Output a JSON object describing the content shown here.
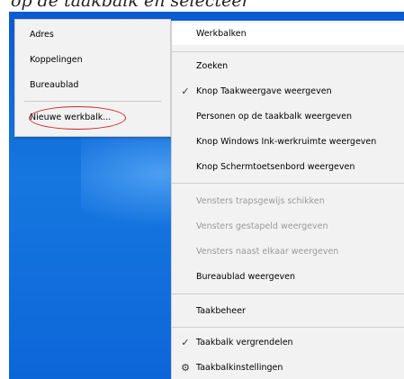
{
  "caption": "op de taakbalk en selecteer",
  "submenu": {
    "items": [
      {
        "label": "Adres"
      },
      {
        "label": "Koppelingen"
      },
      {
        "label": "Bureaublad"
      }
    ],
    "new_toolbar": "Nieuwe werkbalk..."
  },
  "menu": {
    "toolbars": "Werkbalken",
    "search": "Zoeken",
    "task_view": "Knop Taakweergave weergeven",
    "people": "Personen op de taakbalk weergeven",
    "ink": "Knop Windows Ink-werkruimte weergeven",
    "keyboard": "Knop Schermtoetsenbord weergeven",
    "cascade": "Vensters trapsgewijs schikken",
    "stacked": "Vensters gestapeld weergeven",
    "side_by_side": "Vensters naast elkaar weergeven",
    "show_desktop": "Bureaublad weergeven",
    "task_manager": "Taakbeheer",
    "lock": "Taakbalk vergrendelen",
    "settings": "Taakbalkinstellingen"
  },
  "colors": {
    "menu_bg": "#f2f2f2",
    "highlight": "#ffffff",
    "desktop": "#1677e0",
    "circle": "#c8262b",
    "disabled": "#9a9a9a"
  }
}
